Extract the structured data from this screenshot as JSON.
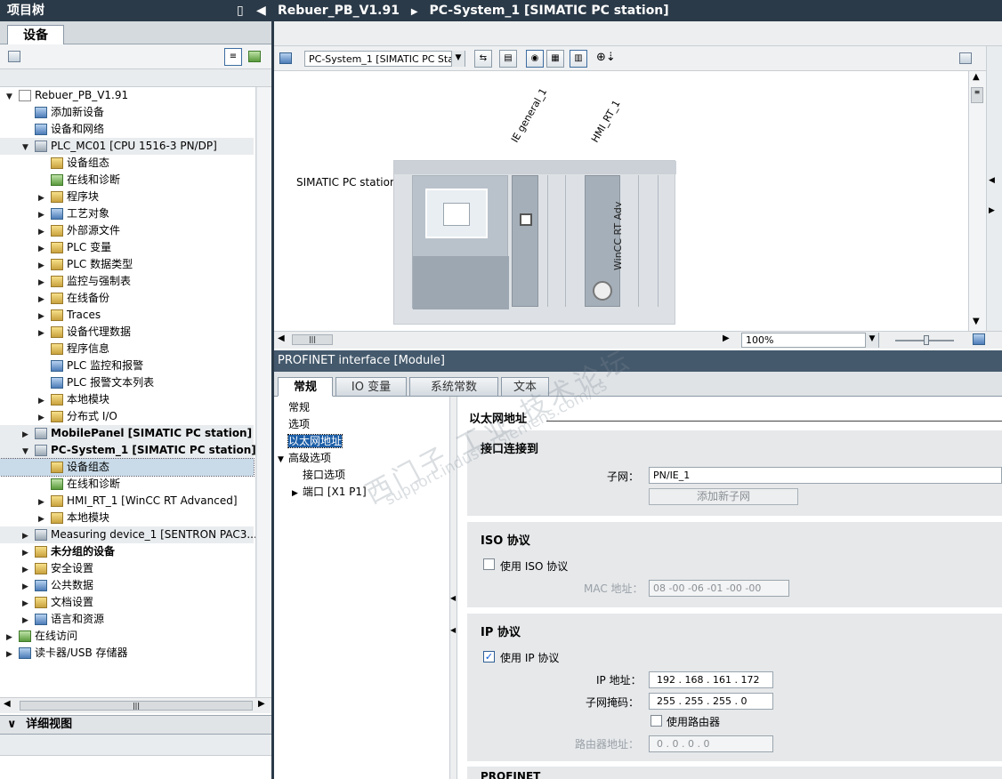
{
  "project_tree": {
    "title": "项目树",
    "tab": "设备",
    "items": [
      {
        "label": "Rebuer_PB_V1.91",
        "expand": "▼"
      },
      {
        "label": "添加新设备",
        "expand": ""
      },
      {
        "label": "设备和网络",
        "expand": ""
      },
      {
        "label": "PLC_MC01 [CPU 1516-3 PN/DP]",
        "expand": "▼"
      },
      {
        "label": "设备组态",
        "expand": ""
      },
      {
        "label": "在线和诊断",
        "expand": ""
      },
      {
        "label": "程序块",
        "expand": "▶"
      },
      {
        "label": "工艺对象",
        "expand": "▶"
      },
      {
        "label": "外部源文件",
        "expand": "▶"
      },
      {
        "label": "PLC 变量",
        "expand": "▶"
      },
      {
        "label": "PLC 数据类型",
        "expand": "▶"
      },
      {
        "label": "监控与强制表",
        "expand": "▶"
      },
      {
        "label": "在线备份",
        "expand": "▶"
      },
      {
        "label": "Traces",
        "expand": "▶"
      },
      {
        "label": "设备代理数据",
        "expand": "▶"
      },
      {
        "label": "程序信息",
        "expand": ""
      },
      {
        "label": "PLC 监控和报警",
        "expand": ""
      },
      {
        "label": "PLC 报警文本列表",
        "expand": ""
      },
      {
        "label": "本地模块",
        "expand": "▶"
      },
      {
        "label": "分布式 I/O",
        "expand": "▶"
      },
      {
        "label": "MobilePanel [SIMATIC PC station]",
        "expand": "▶"
      },
      {
        "label": "PC-System_1 [SIMATIC PC station]",
        "expand": "▼"
      },
      {
        "label": "设备组态",
        "expand": ""
      },
      {
        "label": "在线和诊断",
        "expand": ""
      },
      {
        "label": "HMI_RT_1 [WinCC RT Advanced]",
        "expand": "▶"
      },
      {
        "label": "本地模块",
        "expand": "▶"
      },
      {
        "label": "Measuring device_1 [SENTRON PAC3...",
        "expand": "▶"
      },
      {
        "label": "未分组的设备",
        "expand": "▶"
      },
      {
        "label": "安全设置",
        "expand": "▶"
      },
      {
        "label": "公共数据",
        "expand": "▶"
      },
      {
        "label": "文档设置",
        "expand": "▶"
      },
      {
        "label": "语言和资源",
        "expand": "▶"
      },
      {
        "label": "在线访问",
        "expand": "▶"
      },
      {
        "label": "读卡器/USB 存储器",
        "expand": "▶"
      }
    ],
    "detail_view": "详细视图",
    "collapse_arrow": "◀",
    "pin_icon": "▯"
  },
  "breadcrumb": {
    "project": "Rebuer_PB_V1.91",
    "separator": "▶",
    "device": "PC-System_1 [SIMATIC PC station]"
  },
  "device_view": {
    "device_select": "PC-System_1 [SIMATIC PC Stat",
    "station_label": "SIMATIC PC station",
    "module_labels": [
      "IE general_1",
      "HMI_RT_1"
    ],
    "winccrt_text": "WinCC RT Adv",
    "zoom": "100%"
  },
  "props": {
    "title": "PROFINET interface [Module]",
    "tabs": [
      "常规",
      "IO 变量",
      "系统常数",
      "文本"
    ],
    "nav": [
      {
        "label": "常规",
        "expand": ""
      },
      {
        "label": "选项",
        "expand": ""
      },
      {
        "label": "以太网地址",
        "expand": ""
      },
      {
        "label": "高级选项",
        "expand": "▼"
      },
      {
        "label": "接口选项",
        "expand": ""
      },
      {
        "label": "端口 [X1 P1]",
        "expand": "▶"
      }
    ],
    "section_title": "以太网地址",
    "interface": {
      "heading": "接口连接到",
      "subnet_label": "子网：",
      "subnet_value": "PN/IE_1",
      "add_subnet": "添加新子网"
    },
    "iso": {
      "heading": "ISO 协议",
      "use_iso": "使用 ISO 协议",
      "mac_label": "MAC 地址：",
      "mac_value": "08 -00 -06 -01 -00 -00"
    },
    "ip": {
      "heading": "IP 协议",
      "use_ip": "使用 IP 协议",
      "ip_label": "IP 地址：",
      "ip_value": "192 . 168 . 161 . 172",
      "mask_label": "子网掩码：",
      "mask_value": "255 . 255 . 255 . 0",
      "use_router": "使用路由器",
      "router_label": "路由器地址：",
      "router_value": "0 . 0 . 0 . 0"
    },
    "profinet_heading": "PROFINET"
  },
  "watermark": {
    "cn": "西门子 工业 技术论坛",
    "url": "support.industry.siemens.com/cs"
  },
  "colors": {
    "header": "#2b3a48",
    "selection": "#c9dbe9",
    "accent": "#0a5ad8"
  }
}
